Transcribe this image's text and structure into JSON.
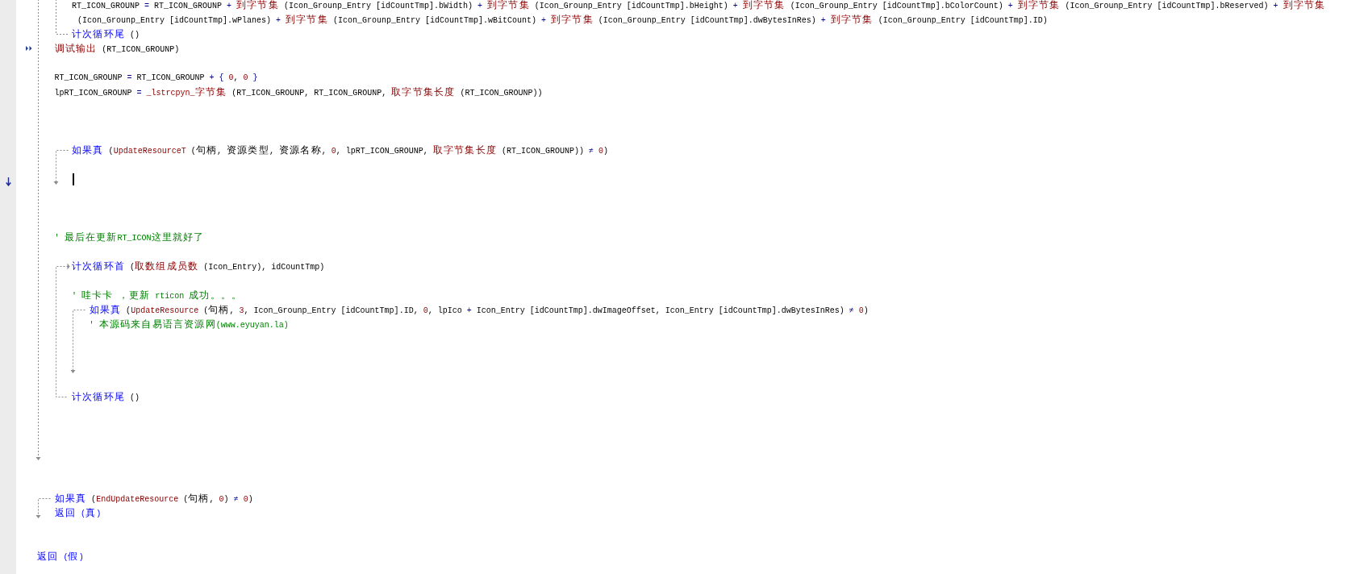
{
  "editor": {
    "lines": [
      {
        "kind": "if",
        "children": [
          {
            "kind": "loop",
            "children": [
              {
                "kind": "line",
                "segments": [
                  {
                    "kind": "txt",
                    "text": "RT_ICON_GROUNP"
                  },
                  {
                    "kind": "op",
                    "text": " = "
                  },
                  {
                    "kind": "txt",
                    "text": "RT_ICON_GROUNP"
                  },
                  {
                    "kind": "op",
                    "text": " + "
                  },
                  {
                    "kind": "fn",
                    "text": "到字节集"
                  },
                  {
                    "kind": "txt",
                    "text": " (Icon_Grounp_Entry [idCountTmp].bWidth)"
                  },
                  {
                    "kind": "op",
                    "text": " + "
                  },
                  {
                    "kind": "fn",
                    "text": "到字节集"
                  },
                  {
                    "kind": "txt",
                    "text": " (Icon_Grounp_Entry [idCountTmp].bHeight)"
                  },
                  {
                    "kind": "op",
                    "text": " + "
                  },
                  {
                    "kind": "fn",
                    "text": "到字节集"
                  },
                  {
                    "kind": "txt",
                    "text": " (Icon_Grounp_Entry [idCountTmp].bColorCount)"
                  },
                  {
                    "kind": "op",
                    "text": " + "
                  },
                  {
                    "kind": "fn",
                    "text": "到字节集"
                  },
                  {
                    "kind": "txt",
                    "text": " (Icon_Grounp_Entry [idCountTmp].bReserved)"
                  },
                  {
                    "kind": "op",
                    "text": " + "
                  },
                  {
                    "kind": "fn",
                    "text": "到字节集"
                  }
                ]
              },
              {
                "kind": "continuation",
                "segments": [
                  {
                    "kind": "txt",
                    "text": "(Icon_Grounp_Entry [idCountTmp].wPlanes)"
                  },
                  {
                    "kind": "op",
                    "text": " + "
                  },
                  {
                    "kind": "fn",
                    "text": "到字节集"
                  },
                  {
                    "kind": "txt",
                    "text": " (Icon_Grounp_Entry [idCountTmp].wBitCount)"
                  },
                  {
                    "kind": "op",
                    "text": " + "
                  },
                  {
                    "kind": "fn",
                    "text": "到字节集"
                  },
                  {
                    "kind": "txt",
                    "text": " (Icon_Grounp_Entry [idCountTmp].dwBytesInRes)"
                  },
                  {
                    "kind": "op",
                    "text": " + "
                  },
                  {
                    "kind": "fn",
                    "text": "到字节集"
                  },
                  {
                    "kind": "txt",
                    "text": " (Icon_Grounp_Entry [idCountTmp].ID)"
                  }
                ]
              }
            ],
            "footer": [
              {
                "kind": "kw",
                "text": "计次循环尾"
              },
              {
                "kind": "txt",
                "text": " ()"
              }
            ]
          },
          {
            "kind": "line",
            "marker": {
              "kind": "run"
            },
            "segments": [
              {
                "kind": "fn",
                "text": "调试输出"
              },
              {
                "kind": "txt",
                "text": " (RT_ICON_GROUNP)"
              }
            ]
          },
          {
            "kind": "blank"
          },
          {
            "kind": "line",
            "segments": [
              {
                "kind": "txt",
                "text": "RT_ICON_GROUNP"
              },
              {
                "kind": "op",
                "text": " = "
              },
              {
                "kind": "txt",
                "text": "RT_ICON_GROUNP"
              },
              {
                "kind": "op",
                "text": " + { "
              },
              {
                "kind": "num",
                "text": "0"
              },
              {
                "kind": "txt",
                "text": ", "
              },
              {
                "kind": "num",
                "text": "0"
              },
              {
                "kind": "op",
                "text": " }"
              }
            ]
          },
          {
            "kind": "line",
            "segments": [
              {
                "kind": "txt",
                "text": "lpRT_ICON_GROUNP"
              },
              {
                "kind": "op",
                "text": " = "
              },
              {
                "kind": "fn",
                "text": "_lstrcpyn_字节集"
              },
              {
                "kind": "txt",
                "text": " (RT_ICON_GROUNP, RT_ICON_GROUNP, "
              },
              {
                "kind": "fn",
                "text": "取字节集长度"
              },
              {
                "kind": "txt",
                "text": " (RT_ICON_GROUNP))"
              }
            ]
          },
          {
            "kind": "blank"
          },
          {
            "kind": "blank"
          },
          {
            "kind": "blank"
          },
          {
            "kind": "if",
            "header": [
              {
                "kind": "kw",
                "text": "如果真"
              },
              {
                "kind": "txt",
                "text": " ("
              },
              {
                "kind": "fn",
                "text": "UpdateResourceT"
              },
              {
                "kind": "txt",
                "text": " (句柄, 资源类型, 资源名称, "
              },
              {
                "kind": "num",
                "text": "0"
              },
              {
                "kind": "txt",
                "text": ", lpRT_ICON_GROUNP, "
              },
              {
                "kind": "fn",
                "text": "取字节集长度"
              },
              {
                "kind": "txt",
                "text": " (RT_ICON_GROUNP))"
              },
              {
                "kind": "op",
                "text": " ≠ "
              },
              {
                "kind": "num",
                "text": "0"
              },
              {
                "kind": "txt",
                "text": ")"
              }
            ],
            "children": [
              {
                "kind": "blank"
              },
              {
                "kind": "caret",
                "marker": {
                  "kind": "down"
                }
              }
            ]
          },
          {
            "kind": "blank"
          },
          {
            "kind": "blank"
          },
          {
            "kind": "blank"
          },
          {
            "kind": "line",
            "segments": [
              {
                "kind": "cmt",
                "text": "' 最后在更新RT_ICON这里就好了"
              }
            ]
          },
          {
            "kind": "blank"
          },
          {
            "kind": "loop",
            "header": [
              {
                "kind": "kw",
                "text": "计次循环首"
              },
              {
                "kind": "txt",
                "text": " ("
              },
              {
                "kind": "fn",
                "text": "取数组成员数"
              },
              {
                "kind": "txt",
                "text": " (Icon_Entry), idCountTmp)"
              }
            ],
            "children": [
              {
                "kind": "blank"
              },
              {
                "kind": "line",
                "segments": [
                  {
                    "kind": "cmt",
                    "text": "' 哇卡卡 ，更新 rticon 成功。。。"
                  }
                ]
              },
              {
                "kind": "if",
                "header": [
                  {
                    "kind": "kw",
                    "text": "如果真"
                  },
                  {
                    "kind": "txt",
                    "text": " ("
                  },
                  {
                    "kind": "fn",
                    "text": "UpdateResource"
                  },
                  {
                    "kind": "txt",
                    "text": " (句柄, "
                  },
                  {
                    "kind": "num",
                    "text": "3"
                  },
                  {
                    "kind": "txt",
                    "text": ", Icon_Grounp_Entry [idCountTmp].ID, "
                  },
                  {
                    "kind": "num",
                    "text": "0"
                  },
                  {
                    "kind": "txt",
                    "text": ", lpIco"
                  },
                  {
                    "kind": "op",
                    "text": " + "
                  },
                  {
                    "kind": "txt",
                    "text": "Icon_Entry [idCountTmp].dwImageOffset, Icon_Entry [idCountTmp].dwBytesInRes)"
                  },
                  {
                    "kind": "op",
                    "text": " ≠ "
                  },
                  {
                    "kind": "num",
                    "text": "0"
                  },
                  {
                    "kind": "txt",
                    "text": ")"
                  }
                ],
                "children": [
                  {
                    "kind": "line",
                    "segments": [
                      {
                        "kind": "cmt",
                        "text": "' 本源码来自易语言资源网(www.eyuyan.la)"
                      }
                    ]
                  },
                  {
                    "kind": "blank"
                  },
                  {
                    "kind": "blank"
                  },
                  {
                    "kind": "blank"
                  }
                ]
              },
              {
                "kind": "blank"
              }
            ],
            "footer": [
              {
                "kind": "kw",
                "text": "计次循环尾"
              },
              {
                "kind": "txt",
                "text": " ()"
              }
            ]
          },
          {
            "kind": "blank"
          },
          {
            "kind": "blank"
          },
          {
            "kind": "blank"
          },
          {
            "kind": "blank"
          }
        ]
      },
      {
        "kind": "blank"
      },
      {
        "kind": "blank"
      },
      {
        "kind": "if",
        "header": [
          {
            "kind": "kw",
            "text": "如果真"
          },
          {
            "kind": "txt",
            "text": " ("
          },
          {
            "kind": "fn",
            "text": "EndUpdateResource"
          },
          {
            "kind": "txt",
            "text": " (句柄, "
          },
          {
            "kind": "num",
            "text": "0"
          },
          {
            "kind": "txt",
            "text": ")"
          },
          {
            "kind": "op",
            "text": " ≠ "
          },
          {
            "kind": "num",
            "text": "0"
          },
          {
            "kind": "txt",
            "text": ")"
          }
        ],
        "children": [
          {
            "kind": "line",
            "segments": [
              {
                "kind": "kw",
                "text": "返回 (真)"
              }
            ]
          }
        ]
      },
      {
        "kind": "blank"
      },
      {
        "kind": "blank"
      },
      {
        "kind": "line",
        "segments": [
          {
            "kind": "kw",
            "text": "返回 (假)"
          }
        ]
      }
    ]
  }
}
